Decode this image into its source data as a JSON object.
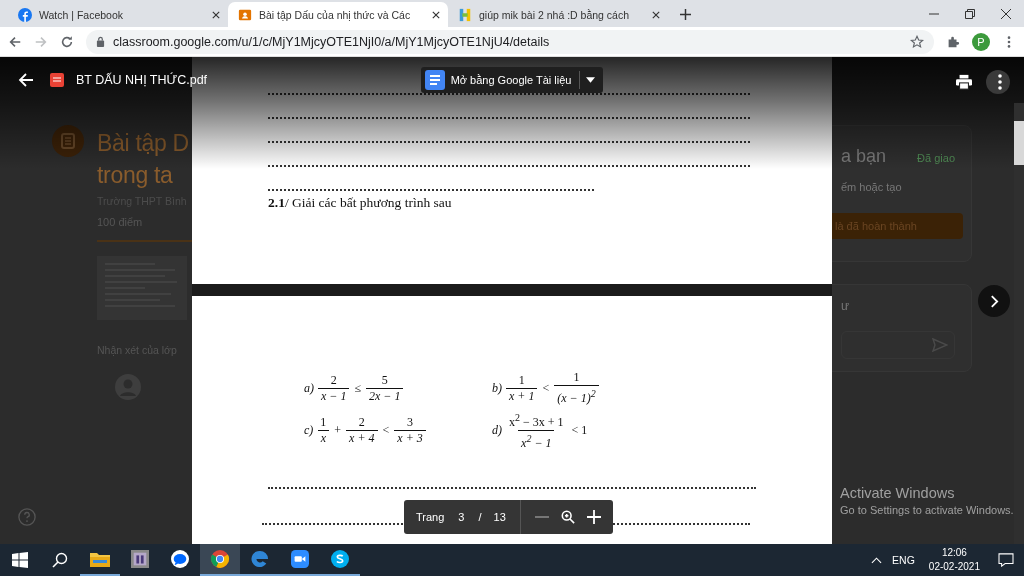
{
  "browser": {
    "tabs": [
      {
        "title": "Watch | Facebook",
        "kind": "facebook",
        "selected": false
      },
      {
        "title": "Bài tập Dấu của nhị thức và Các",
        "kind": "classroom",
        "selected": true
      },
      {
        "title": "giúp mik bài 2 nhá :D bằng cách",
        "kind": "hoidap",
        "selected": false
      }
    ],
    "forward_disabled": true,
    "url": "classroom.google.com/u/1/c/MjY1MjcyOTE1NjI0/a/MjY1MjcyOTE1NjU4/details",
    "profile_initial": "P"
  },
  "background_page": {
    "title_lines": [
      "Bài tập D",
      "trong ta"
    ],
    "school": "Trường THPT Bình",
    "points": "100 điểm",
    "class_comments": "Nhận xét của lớp",
    "work_card": {
      "heading": "a bạn",
      "status": "Đã giao",
      "hint": "ếm hoặc tạo",
      "button": "là đã hoàn thành"
    },
    "private_card": {
      "heading": "ư"
    }
  },
  "viewer": {
    "file_name": "BT DẤU NHỊ THỨC.pdf",
    "open_with": "Mở bằng Google Tài liệu",
    "page1": {
      "heading": "**2.1**/ Giải các bất phương trình sau"
    },
    "problems": [
      {
        "label": "a)",
        "terms": [
          {
            "kind": "frac",
            "num": "2",
            "den": "x − 1"
          },
          {
            "kind": "op",
            "text": "≤"
          },
          {
            "kind": "frac",
            "num": "5",
            "den": "2x − 1"
          }
        ]
      },
      {
        "label": "b)",
        "terms": [
          {
            "kind": "frac",
            "num": "1",
            "den": "x + 1"
          },
          {
            "kind": "op",
            "text": "<"
          },
          {
            "kind": "frac",
            "num": "1",
            "den": "(x − 1)$^{2}$"
          }
        ]
      },
      {
        "label": "c)",
        "terms": [
          {
            "kind": "frac",
            "num": "1",
            "den": "x"
          },
          {
            "kind": "op",
            "text": "+"
          },
          {
            "kind": "frac",
            "num": "2",
            "den": "x + 4"
          },
          {
            "kind": "op",
            "text": "<"
          },
          {
            "kind": "frac",
            "num": "3",
            "den": "x + 3"
          }
        ]
      },
      {
        "label": "d)",
        "terms": [
          {
            "kind": "frac",
            "num": "x$^{2}$ − 3x + 1",
            "den": "x$^{2}$ − 1"
          },
          {
            "kind": "op",
            "text": "< 1"
          }
        ]
      }
    ],
    "pager": {
      "label": "Trang",
      "page": "3",
      "separator": "/",
      "total": "13"
    }
  },
  "activation": {
    "title": "Activate Windows",
    "subtitle": "Go to Settings to activate Windows."
  },
  "taskbar": {
    "apps": [
      {
        "kind": "explorer",
        "running": true,
        "selected": false
      },
      {
        "kind": "ip",
        "running": false,
        "selected": false
      },
      {
        "kind": "zalo",
        "running": false,
        "selected": false
      },
      {
        "kind": "chrome",
        "running": true,
        "selected": true
      },
      {
        "kind": "edge",
        "running": true,
        "selected": false
      },
      {
        "kind": "zoom",
        "running": true,
        "selected": false
      },
      {
        "kind": "skype",
        "running": true,
        "selected": false
      }
    ],
    "language": "ENG",
    "time": "12:06",
    "date": "02-02-2021"
  }
}
